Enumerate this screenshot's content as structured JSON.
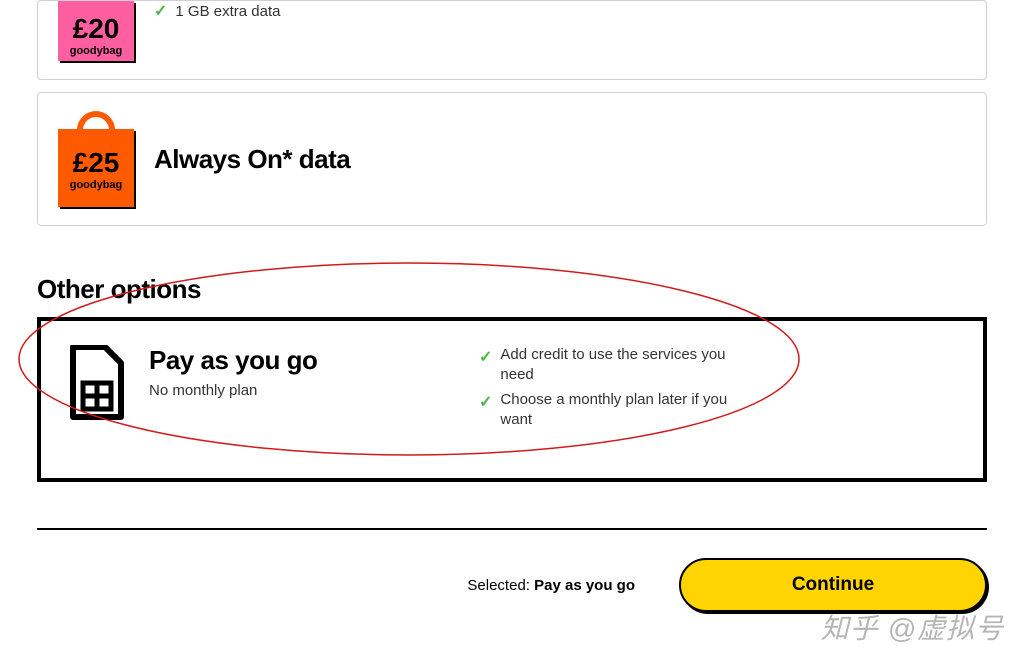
{
  "plans": {
    "p20": {
      "price": "£20",
      "tag": "goodybag",
      "feature": "1 GB extra data"
    },
    "p25": {
      "price": "£25",
      "tag": "goodybag",
      "title": "Always On* data"
    }
  },
  "other_options_heading": "Other options",
  "payg": {
    "title": "Pay as you go",
    "subtitle": "No monthly plan",
    "features": [
      "Add credit to use the services you need",
      "Choose a monthly plan later if you want"
    ]
  },
  "footer": {
    "selected_label": "Selected:",
    "selected_value": "Pay as you go",
    "continue_label": "Continue"
  },
  "watermark": "知乎 @虚拟号",
  "colors": {
    "accent_yellow": "#ffd400",
    "goodybag_pink": "#ff5fa0",
    "goodybag_orange": "#ff5a00",
    "check_green": "#4bb543"
  }
}
